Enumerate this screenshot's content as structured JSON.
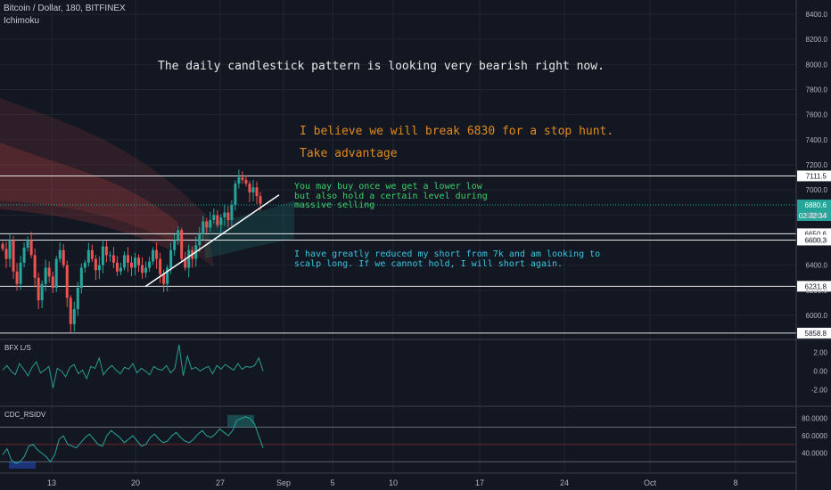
{
  "header": {
    "symbol": "Bitcoin / Dollar, 180, BITFINEX",
    "indicator": "Ichimoku"
  },
  "colors": {
    "background": "#131722",
    "grid": "#1f2433",
    "up_candle": "#26a69a",
    "down_candle": "#ef5350",
    "annotation_white": "#e6e6e6",
    "annotation_orange": "#e08a1e",
    "annotation_green": "#3bd36a",
    "annotation_cyan": "#3cc6e0",
    "current_price_badge": "#26a69a"
  },
  "annotations": [
    {
      "id": "headline",
      "text": "The daily candlestick pattern is looking very bearish right now.",
      "color": "annotation_white"
    },
    {
      "id": "stop-hunt",
      "text": "I believe we will break 6830 for a stop hunt.",
      "color": "annotation_orange"
    },
    {
      "id": "take-advantage",
      "text": "Take advantage",
      "color": "annotation_orange"
    },
    {
      "id": "buy-note",
      "text": "You may buy once we get a lower low\nbut also hold a certain level during\nmassive selling",
      "color": "annotation_green"
    },
    {
      "id": "short-note",
      "text": "I have greatly reduced my short from 7k and am looking to\nscalp long. If we cannot hold, I will short again.",
      "color": "annotation_cyan"
    }
  ],
  "chart_data": [
    {
      "type": "candlestick",
      "title": "Bitcoin / Dollar, 180, BITFINEX",
      "ylim": [
        5800,
        8500
      ],
      "y_ticks": [
        6000,
        6200,
        6400,
        6600,
        6800,
        7000,
        7200,
        7400,
        7600,
        7800,
        8000,
        8200,
        8400
      ],
      "y_tick_labels": [
        "6000.0",
        "6200.0",
        "6400.0",
        "6600.0",
        "6800.0",
        "7000.0",
        "7200.0",
        "7400.0",
        "7600.0",
        "7800.0",
        "8000.0",
        "8200.0",
        "8400.0"
      ],
      "x_ticks": [
        "13",
        "20",
        "27",
        "Sep",
        "5",
        "10",
        "17",
        "24",
        "Oct",
        "8"
      ],
      "horizontal_levels": [
        {
          "label": "7111.5",
          "value": 7111.5
        },
        {
          "label": "6650.6",
          "value": 6650.6
        },
        {
          "label": "6600.3",
          "value": 6600.3
        },
        {
          "label": "6231.8",
          "value": 6231.8
        },
        {
          "label": "5858.8",
          "value": 5858.8
        }
      ],
      "current_price": {
        "label": "6880.6",
        "value": 6880.6,
        "countdown": "02:32:34"
      },
      "trendline": {
        "start": {
          "date": "Aug 20",
          "price": 6230
        },
        "end": {
          "date": "Aug 31",
          "price": 6960
        }
      },
      "series": [
        {
          "type": "candlestick",
          "close_path": [
            6530,
            6450,
            6600,
            6350,
            6250,
            6420,
            6540,
            6600,
            6480,
            6300,
            6120,
            6250,
            6380,
            6310,
            6220,
            6450,
            6520,
            6400,
            6140,
            5930,
            6050,
            6220,
            6380,
            6420,
            6520,
            6450,
            6360,
            6400,
            6550,
            6480,
            6480,
            6420,
            6350,
            6380,
            6480,
            6420,
            6380,
            6460,
            6400,
            6340,
            6380,
            6430,
            6520,
            6450,
            6330,
            6250,
            6380,
            6520,
            6600,
            6680,
            6450,
            6380,
            6520,
            6450,
            6560,
            6650,
            6750,
            6700,
            6760,
            6800,
            6720,
            6780,
            6820,
            6760,
            6880,
            7050,
            7100,
            7080,
            7050,
            6980,
            7020,
            6950,
            6890
          ]
        }
      ]
    },
    {
      "type": "line",
      "title": "BFX L/S",
      "ylim": [
        -3,
        3
      ],
      "y_ticks": [
        2,
        0,
        -2
      ],
      "y_tick_labels": [
        "2.00",
        "0.00",
        "-2.00"
      ],
      "series": [
        {
          "values": [
            0.1,
            0.6,
            0.0,
            -0.4,
            0.8,
            0.2,
            -0.5,
            0.4,
            1.0,
            -0.2,
            0.1,
            0.5,
            -1.8,
            0.3,
            0.0,
            -0.6,
            0.4,
            0.7,
            -0.3,
            0.1,
            -0.8,
            0.5,
            0.3,
            1.4,
            -0.4,
            0.2,
            0.6,
            0.1,
            -0.3,
            0.4,
            0.2,
            0.8,
            -0.2,
            0.3,
            0.0,
            -0.4,
            0.5,
            0.2,
            0.1,
            0.6,
            -0.2,
            0.3,
            2.8,
            -0.5,
            1.6,
            0.2,
            0.4,
            0.0,
            0.3,
            0.5,
            -0.3,
            0.6,
            0.2,
            0.7,
            0.4,
            0.1,
            0.8,
            0.2,
            0.5,
            0.4,
            0.6,
            1.4,
            0.0
          ]
        }
      ]
    },
    {
      "type": "line",
      "title": "CDC_RSIDV",
      "ylim": [
        20,
        90
      ],
      "y_ticks": [
        80,
        60,
        40
      ],
      "y_tick_labels": [
        "80.0000",
        "60.0000",
        "40.0000"
      ],
      "reference_lines": [
        70,
        50,
        30
      ],
      "series": [
        {
          "values": [
            38,
            45,
            32,
            28,
            30,
            36,
            48,
            50,
            44,
            40,
            36,
            30,
            38,
            56,
            60,
            50,
            48,
            46,
            52,
            58,
            62,
            56,
            50,
            48,
            60,
            66,
            62,
            58,
            52,
            56,
            60,
            54,
            48,
            50,
            58,
            62,
            56,
            52,
            54,
            60,
            64,
            58,
            54,
            52,
            56,
            62,
            66,
            60,
            58,
            62,
            68,
            64,
            60,
            66,
            78,
            80,
            82,
            80,
            74,
            60,
            46
          ]
        }
      ]
    }
  ]
}
